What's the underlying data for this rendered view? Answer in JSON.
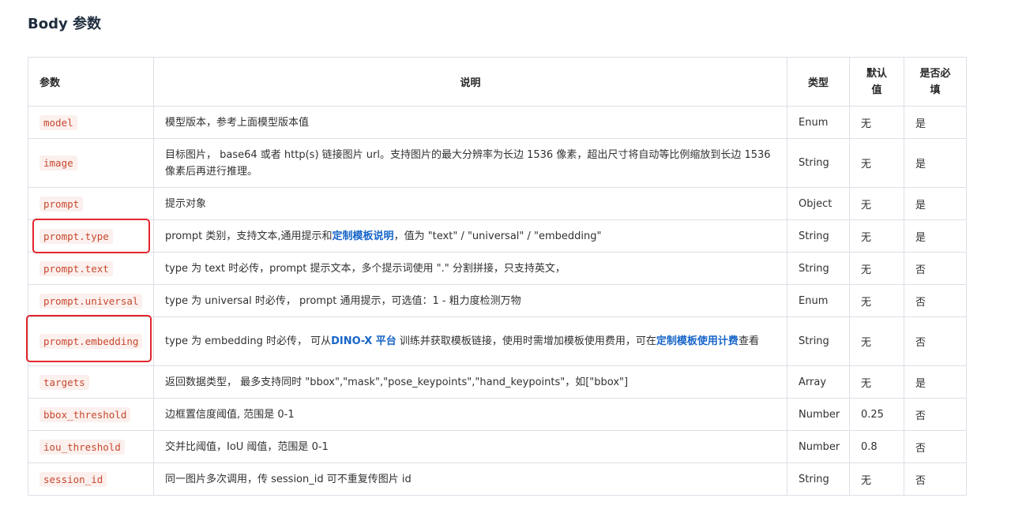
{
  "section_title": "Body 参数",
  "columns": [
    "参数",
    "说明",
    "类型",
    "默认\n值",
    "是否必\n填"
  ],
  "rows": [
    {
      "param": "model",
      "desc": "模型版本，参考上面模型版本值",
      "type": "Enum",
      "default": "无",
      "required": "是"
    },
    {
      "param": "image",
      "desc": "目标图片， base64 或者 http(s) 链接图片 url。支持图片的最大分辨率为长边 1536 像素，超出尺寸将自动等比例缩放到长边 1536 像素后再进行推理。",
      "type": "String",
      "default": "无",
      "required": "是"
    },
    {
      "param": "prompt",
      "desc": "提示对象",
      "type": "Object",
      "default": "无",
      "required": "是"
    },
    {
      "param": "prompt.type",
      "desc_before": "prompt 类别，支持文本,通用提示和",
      "desc_link": "定制模板说明",
      "desc_after": "，值为 \"text\" / \"universal\" / \"embedding\"",
      "type": "String",
      "default": "无",
      "required": "是"
    },
    {
      "param": "prompt.text",
      "desc": "type 为 text 时必传，prompt 提示文本，多个提示词使用 \".\" 分割拼接，只支持英文，",
      "type": "String",
      "default": "无",
      "required": "否"
    },
    {
      "param": "prompt.universal",
      "desc": "type 为 universal 时必传， prompt 通用提示，可选值：1 - 粗力度检测万物",
      "type": "Enum",
      "default": "无",
      "required": "否"
    },
    {
      "param": "prompt.embedding",
      "desc_before": "type 为 embedding 时必传， 可从",
      "desc_link": "DINO-X 平台",
      "desc_middle": " 训练并获取模板链接，使用时需增加模板使用费用，可在",
      "desc_link2": "定制模板使用计费",
      "desc_after": "查看",
      "type": "String",
      "default": "无",
      "required": "否"
    },
    {
      "param": "targets",
      "desc": "返回数据类型， 最多支持同时 \"bbox\",\"mask\",\"pose_keypoints\",\"hand_keypoints\"，如[\"bbox\"]",
      "type": "Array",
      "default": "无",
      "required": "是"
    },
    {
      "param": "bbox_threshold",
      "desc": "边框置信度阈值, 范围是 0-1",
      "type": "Number",
      "default": "0.25",
      "required": "否"
    },
    {
      "param": "iou_threshold",
      "desc": "交并比阈值，IoU 阈值，范围是 0-1",
      "type": "Number",
      "default": "0.8",
      "required": "否"
    },
    {
      "param": "session_id",
      "desc": "同一图片多次调用，传 session_id 可不重复传图片 id",
      "type": "String",
      "default": "无",
      "required": "否"
    }
  ]
}
